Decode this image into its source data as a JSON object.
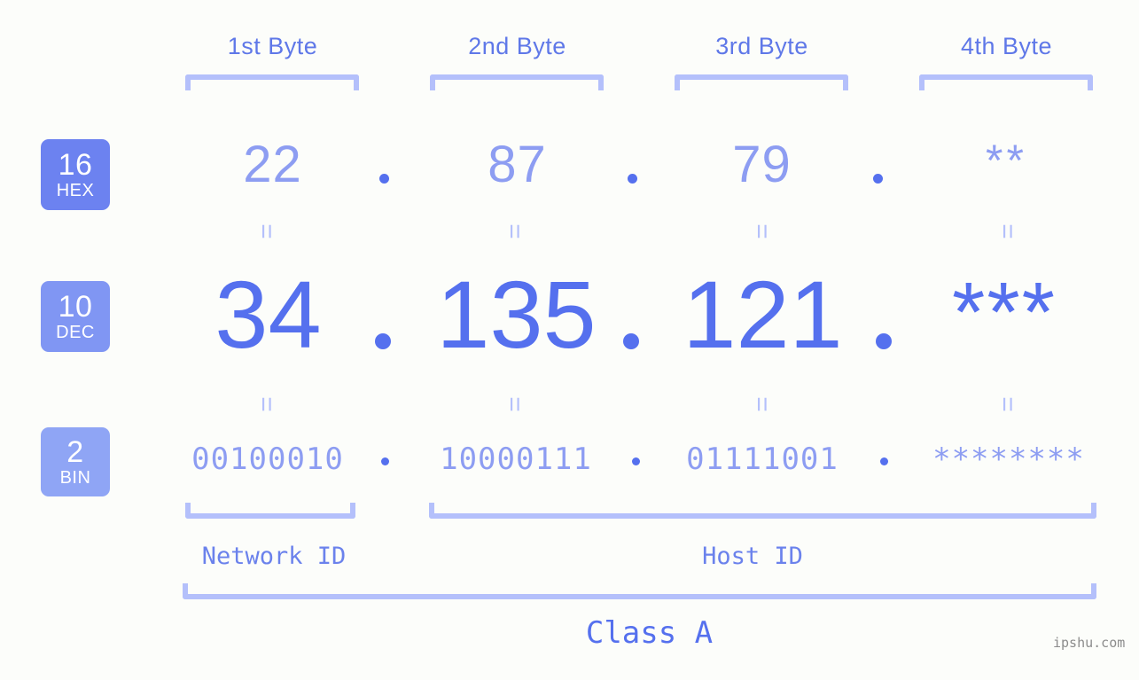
{
  "meta": {
    "background_color": "#fcfdfa",
    "accent_strong": "#5570ee",
    "accent_light": "#8d9df2",
    "bracket_color": "#b4c0fb",
    "watermark": "ipshu.com"
  },
  "header": {
    "byte_labels": [
      {
        "label": "1st Byte"
      },
      {
        "label": "2nd Byte"
      },
      {
        "label": "3rd Byte"
      },
      {
        "label": "4th Byte"
      }
    ]
  },
  "bases": [
    {
      "number": "16",
      "name": "HEX",
      "color": "#6c82f0"
    },
    {
      "number": "10",
      "name": "DEC",
      "color": "#8096f3"
    },
    {
      "number": "2",
      "name": "BIN",
      "color": "#8fa5f5"
    }
  ],
  "rows": {
    "hex": {
      "base_number": "16",
      "base_name": "HEX",
      "values": [
        "22",
        "87",
        "79",
        "**"
      ],
      "separator": "."
    },
    "dec": {
      "base_number": "10",
      "base_name": "DEC",
      "values": [
        "34",
        "135",
        "121",
        "***"
      ],
      "separator": "."
    },
    "bin": {
      "base_number": "2",
      "base_name": "BIN",
      "values": [
        "00100010",
        "10000111",
        "01111001",
        "********"
      ],
      "separator": "."
    }
  },
  "equals": {
    "symbol": "="
  },
  "footer": {
    "network_id_label": "Network ID",
    "host_id_label": "Host ID",
    "class_label": "Class A"
  }
}
